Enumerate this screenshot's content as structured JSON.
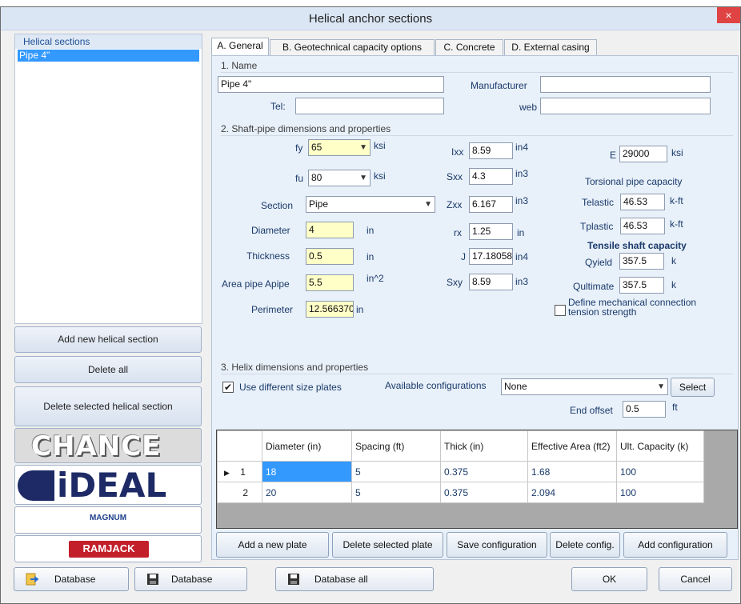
{
  "window": {
    "title": "Helical anchor sections",
    "close_glyph": "×"
  },
  "left_panel": {
    "header": "Helical sections",
    "items": [
      "Pipe 4\""
    ],
    "add_button": "Add new helical section",
    "delete_all_button": "Delete all",
    "delete_selected_button": "Delete selected helical section",
    "logos": [
      "CHANCE",
      "iDEAL",
      "MAGNUM",
      "RAMJACK"
    ]
  },
  "tabs": [
    "A. General",
    "B. Geotechnical capacity options",
    "C. Concrete",
    "D. External casing"
  ],
  "name_section": {
    "title": "1. Name",
    "name_value": "Pipe 4\"",
    "manufacturer_label": "Manufacturer",
    "manufacturer_value": "",
    "tel_label": "Tel:",
    "tel_value": "",
    "web_label": "web",
    "web_value": ""
  },
  "shaft": {
    "title": "2. Shaft-pipe dimensions and properties",
    "fy_label": "fy",
    "fy_value": "65",
    "fy_unit": "ksi",
    "fu_label": "fu",
    "fu_value": "80",
    "fu_unit": "ksi",
    "section_label": "Section",
    "section_value": "Pipe",
    "diameter_label": "Diameter",
    "diameter_value": "4",
    "diameter_unit": "in",
    "thickness_label": "Thickness",
    "thickness_value": "0.5",
    "thickness_unit": "in",
    "area_label": "Area pipe Apipe",
    "area_value": "5.5",
    "area_unit": "in^2",
    "perimeter_label": "Perimeter",
    "perimeter_value": "12.566370",
    "perimeter_unit": "in",
    "ixx_label": "Ixx",
    "ixx_value": "8.59",
    "ixx_unit": "in4",
    "sxx_label": "Sxx",
    "sxx_value": "4.3",
    "sxx_unit": "in3",
    "zxx_label": "Zxx",
    "zxx_value": "6.167",
    "zxx_unit": "in3",
    "rx_label": "rx",
    "rx_value": "1.25",
    "rx_unit": "in",
    "j_label": "J",
    "j_value": "17.18058",
    "j_unit": "in4",
    "sxy_label": "Sxy",
    "sxy_value": "8.59",
    "sxy_unit": "in3",
    "e_label": "E",
    "e_value": "29000",
    "e_unit": "ksi",
    "torsional_head": "Torsional pipe capacity",
    "telastic_label": "Telastic",
    "telastic_value": "46.53",
    "telastic_unit": "k-ft",
    "tplastic_label": "Tplastic",
    "tplastic_value": "46.53",
    "tplastic_unit": "k-ft",
    "tensile_head": "Tensile shaft capacity",
    "qyield_label": "Qyield",
    "qyield_value": "357.5",
    "qyield_unit": "k",
    "qultimate_label": "Qultimate",
    "qultimate_value": "357.5",
    "qultimate_unit": "k",
    "define_mech_label": "Define mechanical connection tension strength",
    "define_mech_checked": false
  },
  "helix": {
    "title": "3. Helix dimensions and properties",
    "use_diff_label": "Use different size plates",
    "use_diff_checked": true,
    "check_glyph": "✔",
    "available_label": "Available configurations",
    "available_value": "None",
    "select_button": "Select",
    "end_offset_label": "End offset",
    "end_offset_value": "0.5",
    "end_offset_unit": "ft"
  },
  "grid": {
    "columns": [
      "Diameter (in)",
      "Spacing (ft)",
      "Thick (in)",
      "Effective Area (ft2)",
      "Ult. Capacity (k)"
    ],
    "rows": [
      {
        "num": "1",
        "indicator": "▶",
        "cells": [
          "18",
          "5",
          "0.375",
          "1.68",
          "100"
        ]
      },
      {
        "num": "2",
        "indicator": "",
        "cells": [
          "20",
          "5",
          "0.375",
          "2.094",
          "100"
        ]
      }
    ]
  },
  "grid_buttons": [
    "Add a new plate",
    "Delete selected plate",
    "Save configuration",
    "Delete config.",
    "Add configuration"
  ],
  "bottom": {
    "db_import": "Database",
    "db_save": "Database",
    "db_save_all": "Database all",
    "ok": "OK",
    "cancel": "Cancel"
  },
  "colors": {
    "accent": "#3399ff",
    "field_yellow": "#ffffc8",
    "panel": "#e8f0f9",
    "close": "#e04343"
  }
}
